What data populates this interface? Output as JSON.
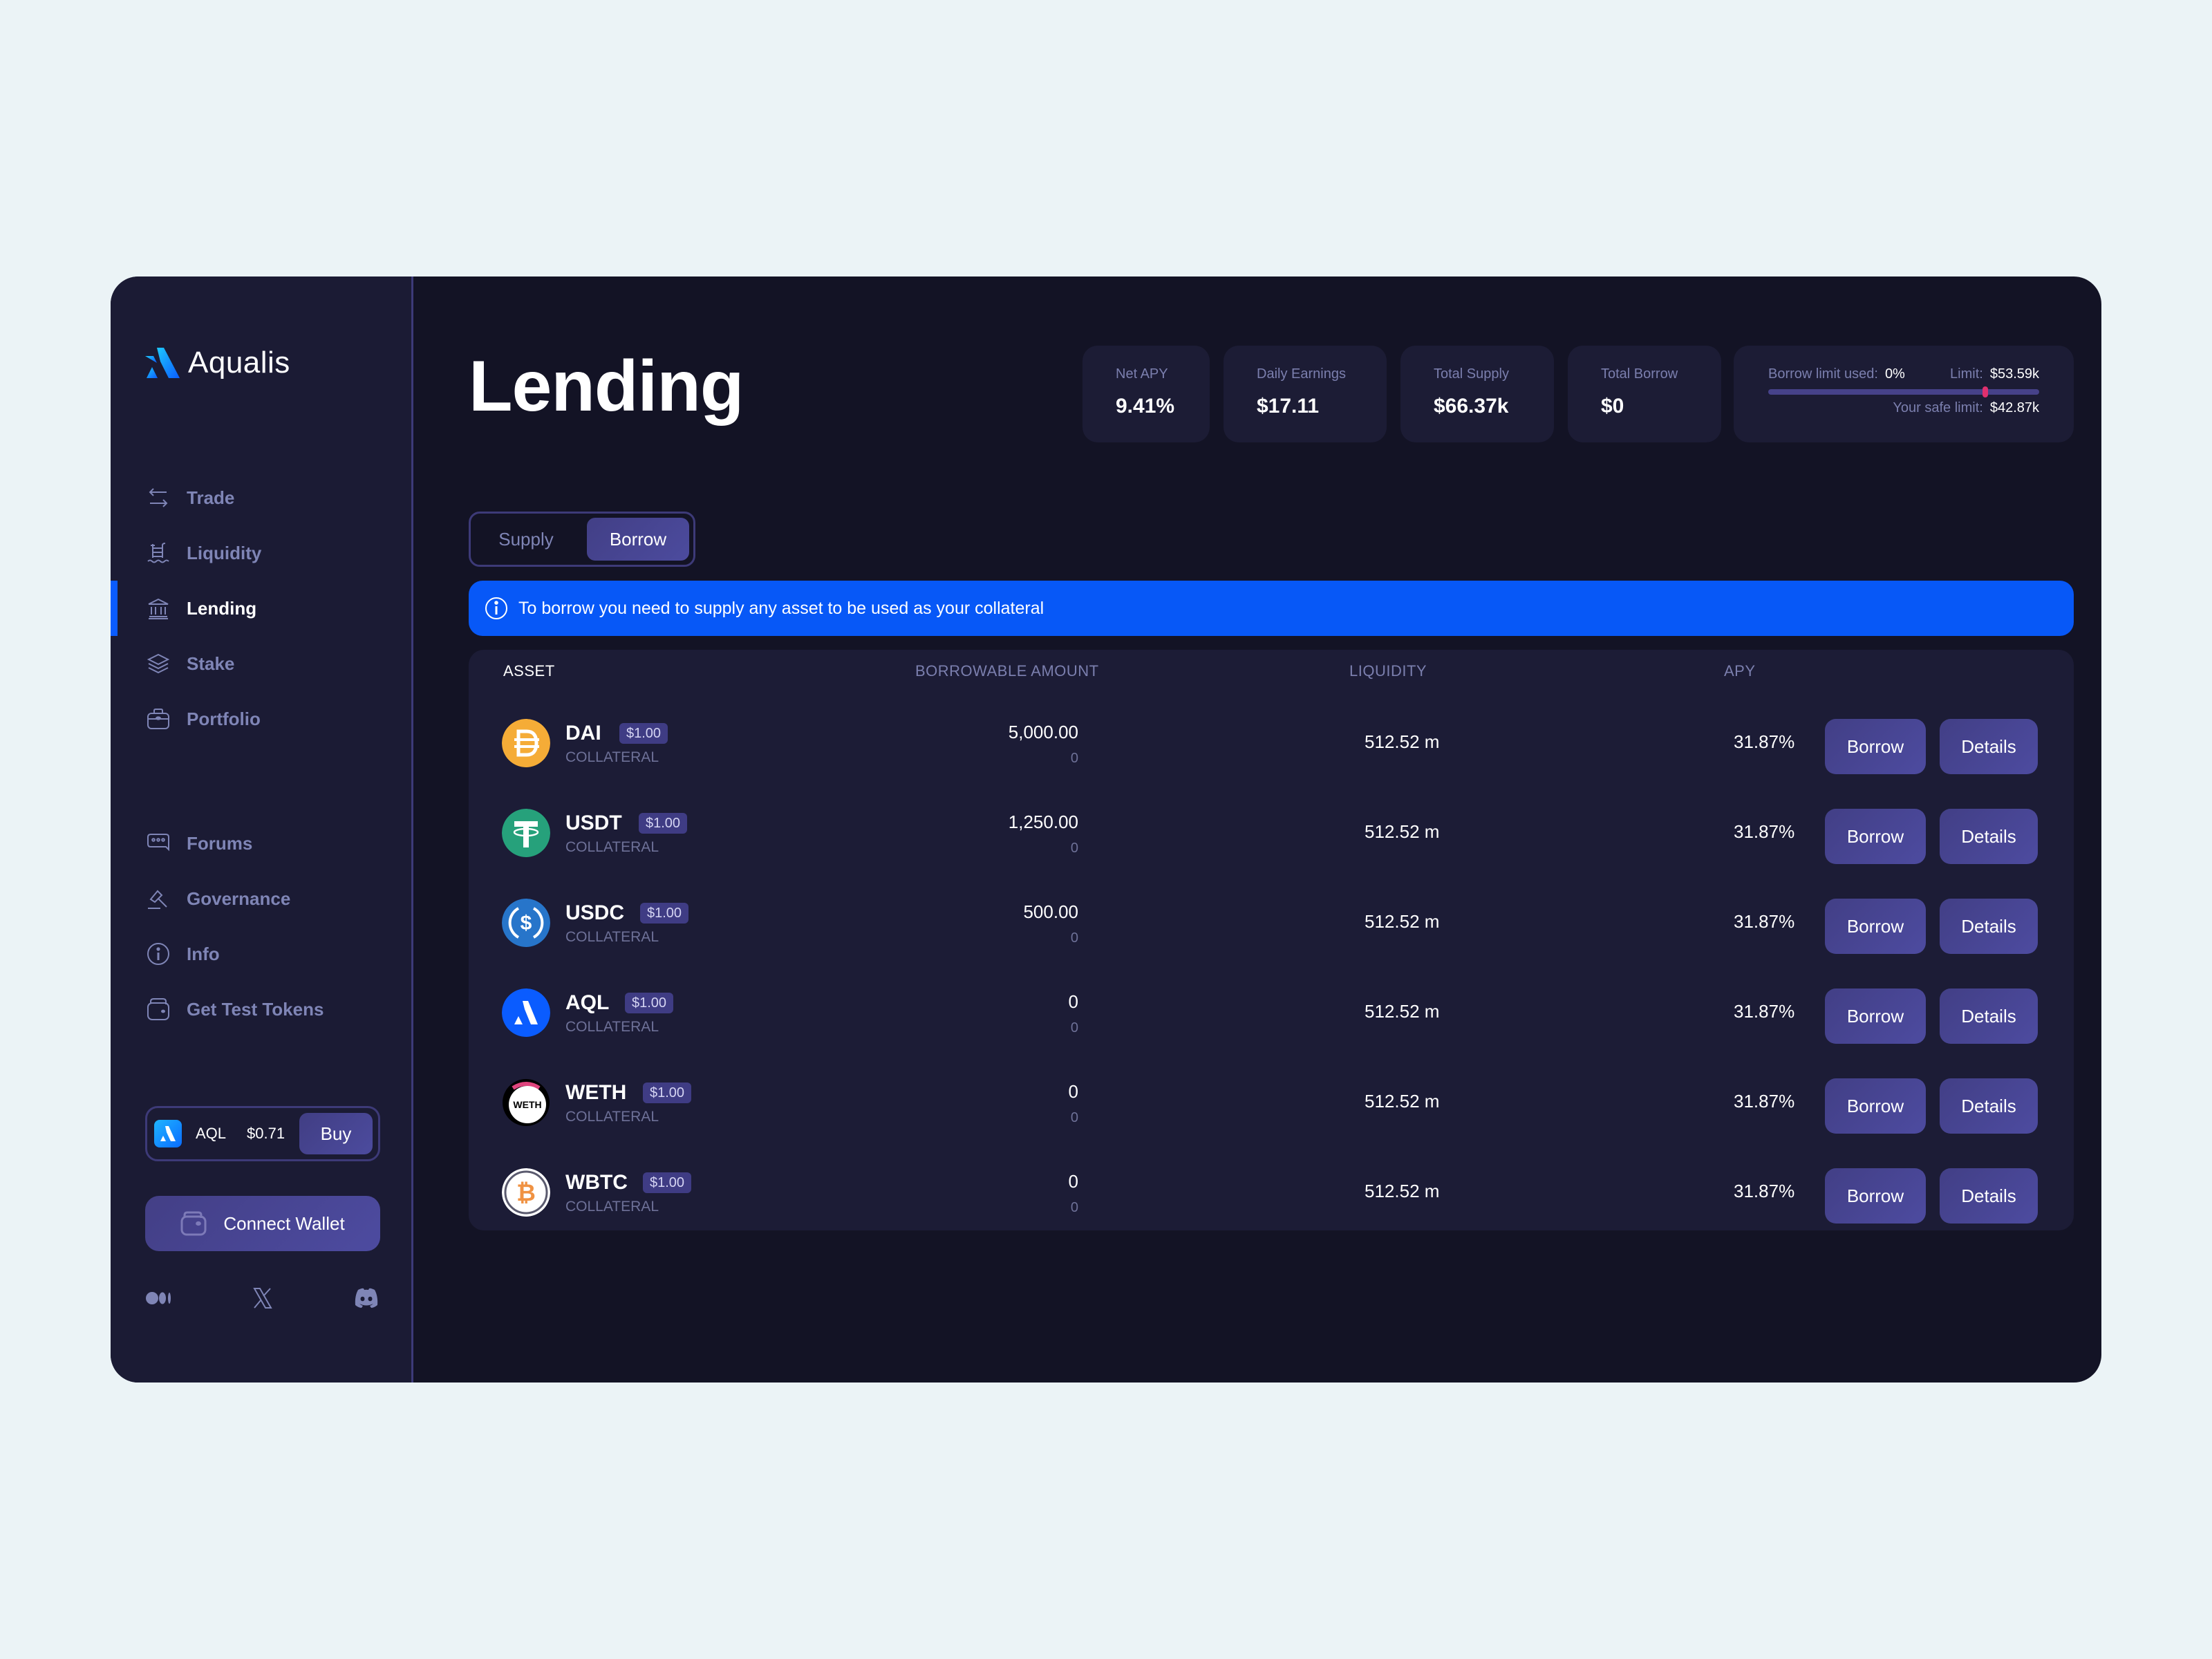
{
  "brand": {
    "name": "Aqualis"
  },
  "nav": {
    "primary": [
      {
        "label": "Trade",
        "icon": "swap-arrows-icon",
        "active": false
      },
      {
        "label": "Liquidity",
        "icon": "pool-ladder-icon",
        "active": false
      },
      {
        "label": "Lending",
        "icon": "bank-icon",
        "active": true
      },
      {
        "label": "Stake",
        "icon": "layers-icon",
        "active": false
      },
      {
        "label": "Portfolio",
        "icon": "briefcase-icon",
        "active": false
      }
    ],
    "secondary": [
      {
        "label": "Forums",
        "icon": "chat-bubble-icon"
      },
      {
        "label": "Governance",
        "icon": "gavel-icon"
      },
      {
        "label": "Info",
        "icon": "info-icon"
      },
      {
        "label": "Get Test Tokens",
        "icon": "wallet-icon"
      }
    ]
  },
  "token_widget": {
    "symbol": "AQL",
    "price": "$0.71",
    "buy_label": "Buy"
  },
  "connect_wallet_label": "Connect Wallet",
  "socials": [
    "medium-icon",
    "x-icon",
    "discord-icon"
  ],
  "page": {
    "title": "Lending"
  },
  "stats": [
    {
      "label": "Net APY",
      "value": "9.41%"
    },
    {
      "label": "Daily Earnings",
      "value": "$17.11"
    },
    {
      "label": "Total Supply",
      "value": "$66.37k"
    },
    {
      "label": "Total Borrow",
      "value": "$0"
    }
  ],
  "borrow_limit": {
    "used_label": "Borrow limit used:",
    "used_value": "0%",
    "used_fraction": 0,
    "limit_label": "Limit:",
    "limit_value": "$53.59k",
    "safe_label": "Your safe limit:",
    "safe_value": "$42.87k",
    "safe_fraction": 0.8
  },
  "tabs": {
    "supply": "Supply",
    "borrow": "Borrow",
    "active": "borrow"
  },
  "banner": {
    "text": "To borrow you need to supply any asset to be used as your collateral"
  },
  "table": {
    "headers": {
      "asset": "ASSET",
      "borrowable": "BORROWABLE AMOUNT",
      "liquidity": "LIQUIDITY",
      "apy": "APY"
    },
    "rows": [
      {
        "symbol": "DAI",
        "price": "$1.00",
        "tag": "COLLATERAL",
        "borrowable": "5,000.00",
        "borrowable_sub": "0",
        "liquidity": "512.52 m",
        "apy": "31.87%",
        "borrow_label": "Borrow",
        "details_label": "Details",
        "icon": "dai-coin-icon",
        "color": "#f5ac37"
      },
      {
        "symbol": "USDT",
        "price": "$1.00",
        "tag": "COLLATERAL",
        "borrowable": "1,250.00",
        "borrowable_sub": "0",
        "liquidity": "512.52 m",
        "apy": "31.87%",
        "borrow_label": "Borrow",
        "details_label": "Details",
        "icon": "usdt-coin-icon",
        "color": "#26a17b"
      },
      {
        "symbol": "USDC",
        "price": "$1.00",
        "tag": "COLLATERAL",
        "borrowable": "500.00",
        "borrowable_sub": "0",
        "liquidity": "512.52 m",
        "apy": "31.87%",
        "borrow_label": "Borrow",
        "details_label": "Details",
        "icon": "usdc-coin-icon",
        "color": "#2775ca"
      },
      {
        "symbol": "AQL",
        "price": "$1.00",
        "tag": "COLLATERAL",
        "borrowable": "0",
        "borrowable_sub": "0",
        "liquidity": "512.52 m",
        "apy": "31.87%",
        "borrow_label": "Borrow",
        "details_label": "Details",
        "icon": "aql-coin-icon",
        "color": "#0a5cff"
      },
      {
        "symbol": "WETH",
        "price": "$1.00",
        "tag": "COLLATERAL",
        "borrowable": "0",
        "borrowable_sub": "0",
        "liquidity": "512.52 m",
        "apy": "31.87%",
        "borrow_label": "Borrow",
        "details_label": "Details",
        "icon": "weth-coin-icon",
        "color": "#ffffff"
      },
      {
        "symbol": "WBTC",
        "price": "$1.00",
        "tag": "COLLATERAL",
        "borrowable": "0",
        "borrowable_sub": "0",
        "liquidity": "512.52 m",
        "apy": "31.87%",
        "borrow_label": "Borrow",
        "details_label": "Details",
        "icon": "wbtc-coin-icon",
        "color": "#f09242"
      }
    ]
  },
  "colors": {
    "accent": "#0a5cff",
    "button": "#4a479a",
    "marker": "#e0306e",
    "background": "#131325",
    "sidebar": "#1b1b34"
  }
}
